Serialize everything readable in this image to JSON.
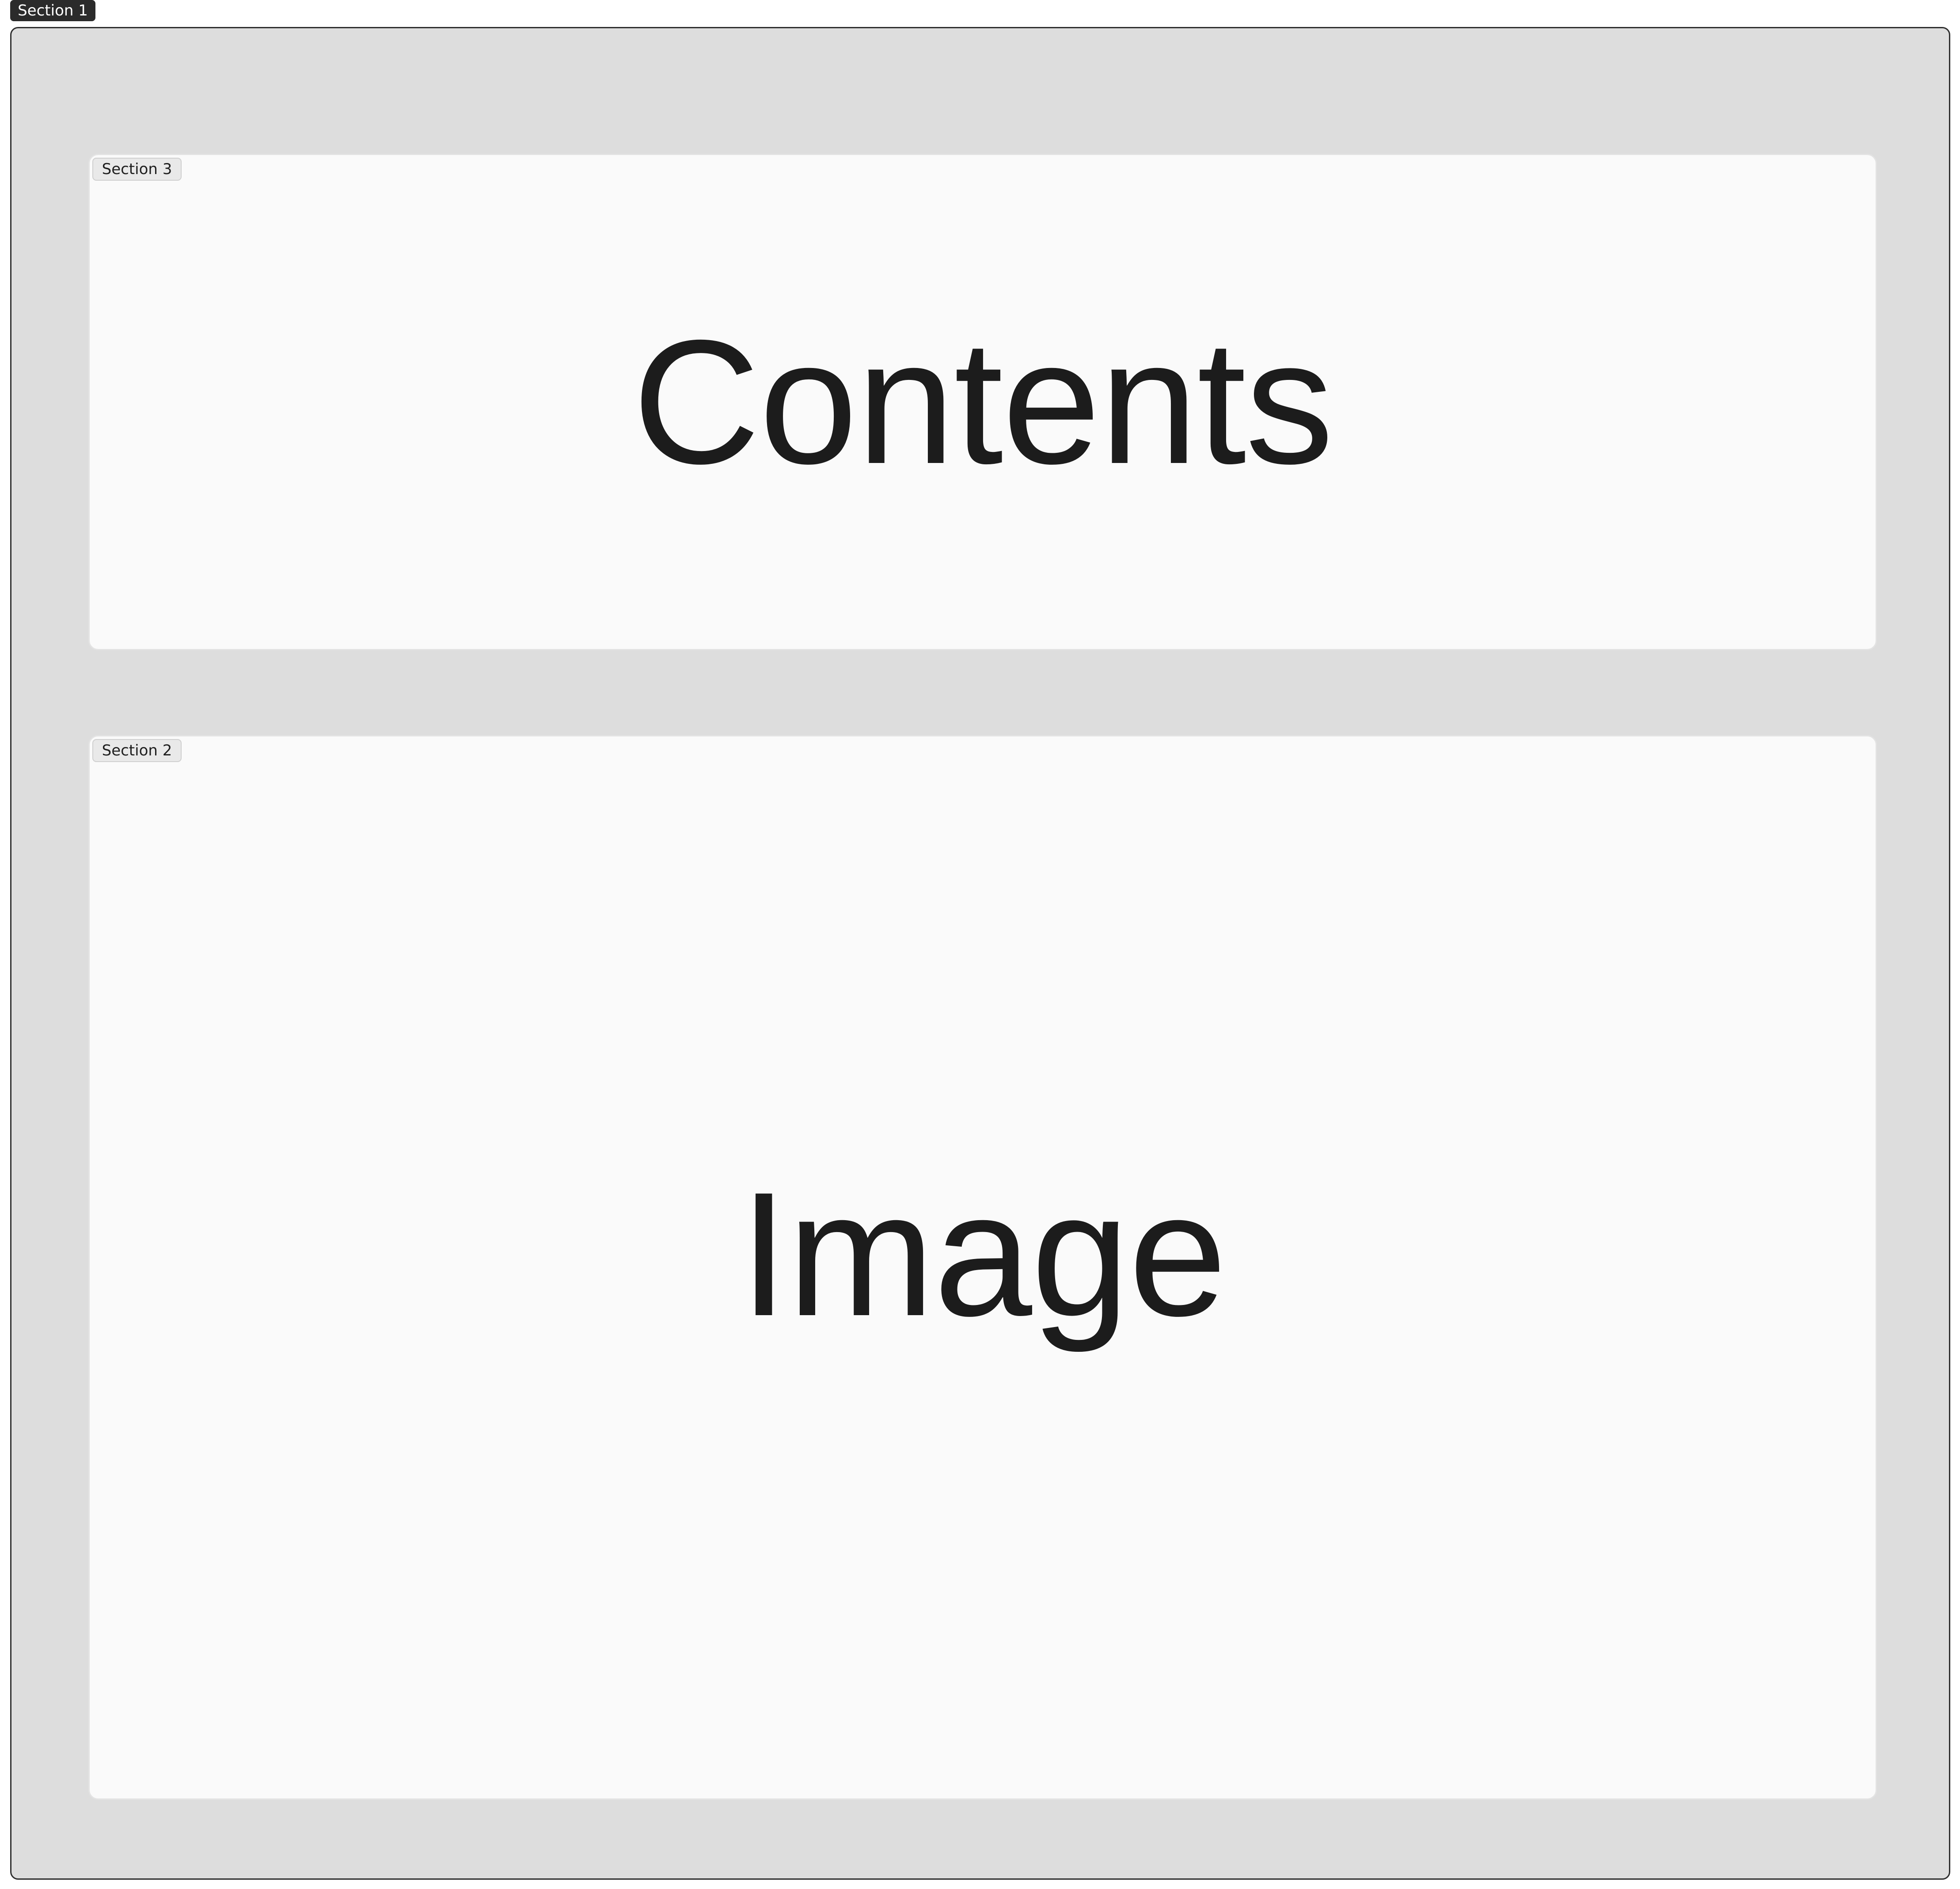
{
  "sections": {
    "outer": {
      "tag": "Section 1"
    },
    "contents": {
      "tag": "Section 3",
      "label": "Contents"
    },
    "image": {
      "tag": "Section 2",
      "label": "Image"
    }
  },
  "colors": {
    "frame_background": "#dddddd",
    "panel_background": "#fafafa",
    "dark_tag_background": "#2b2b2b",
    "label_text": "#1c1c1c"
  }
}
